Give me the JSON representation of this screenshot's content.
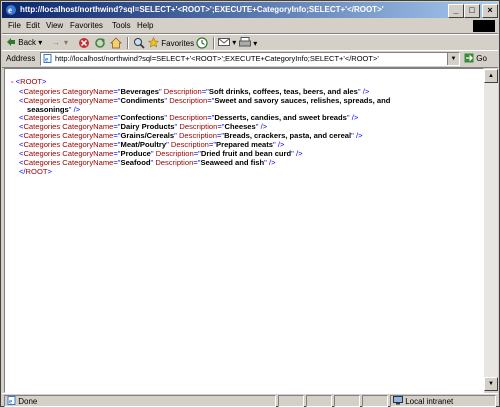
{
  "window": {
    "title": "http://localhost/northwind?sql=SELECT+'<ROOT>';EXECUTE+CategoryInfo;SELECT+'</ROOT>'",
    "controls": [
      "_",
      "□",
      "×"
    ]
  },
  "menu": [
    "File",
    "Edit",
    "View",
    "Favorites",
    "Tools",
    "Help"
  ],
  "toolbar": {
    "back": "Back",
    "forward": "→",
    "favorites": "Favorites"
  },
  "address": {
    "label": "Address",
    "url": "http://localhost/northwind?sql=SELECT+'<ROOT>';EXECUTE+CategoryInfo;SELECT+'</ROOT>'",
    "go": "Go"
  },
  "xml": {
    "minus": "-",
    "root_open": "<ROOT>",
    "root_close": "</ROOT>",
    "tag_name": "Categories",
    "attr1": "CategoryName",
    "attr2": "Description",
    "rows": [
      {
        "name": "Beverages",
        "desc": "Soft drinks, coffees, teas, beers, and ales"
      },
      {
        "name": "Condiments",
        "desc": "Sweet and savory sauces, relishes, spreads, and",
        "desc2": "seasonings"
      },
      {
        "name": "Confections",
        "desc": "Desserts, candies, and sweet breads"
      },
      {
        "name": "Dairy Products",
        "desc": "Cheeses"
      },
      {
        "name": "Grains/Cereals",
        "desc": "Breads, crackers, pasta, and cereal"
      },
      {
        "name": "Meat/Poultry",
        "desc": "Prepared meats"
      },
      {
        "name": "Produce",
        "desc": "Dried fruit and bean curd"
      },
      {
        "name": "Seafood",
        "desc": "Seaweed and fish"
      }
    ]
  },
  "status": {
    "text": "Done",
    "zone": "Local intranet"
  }
}
